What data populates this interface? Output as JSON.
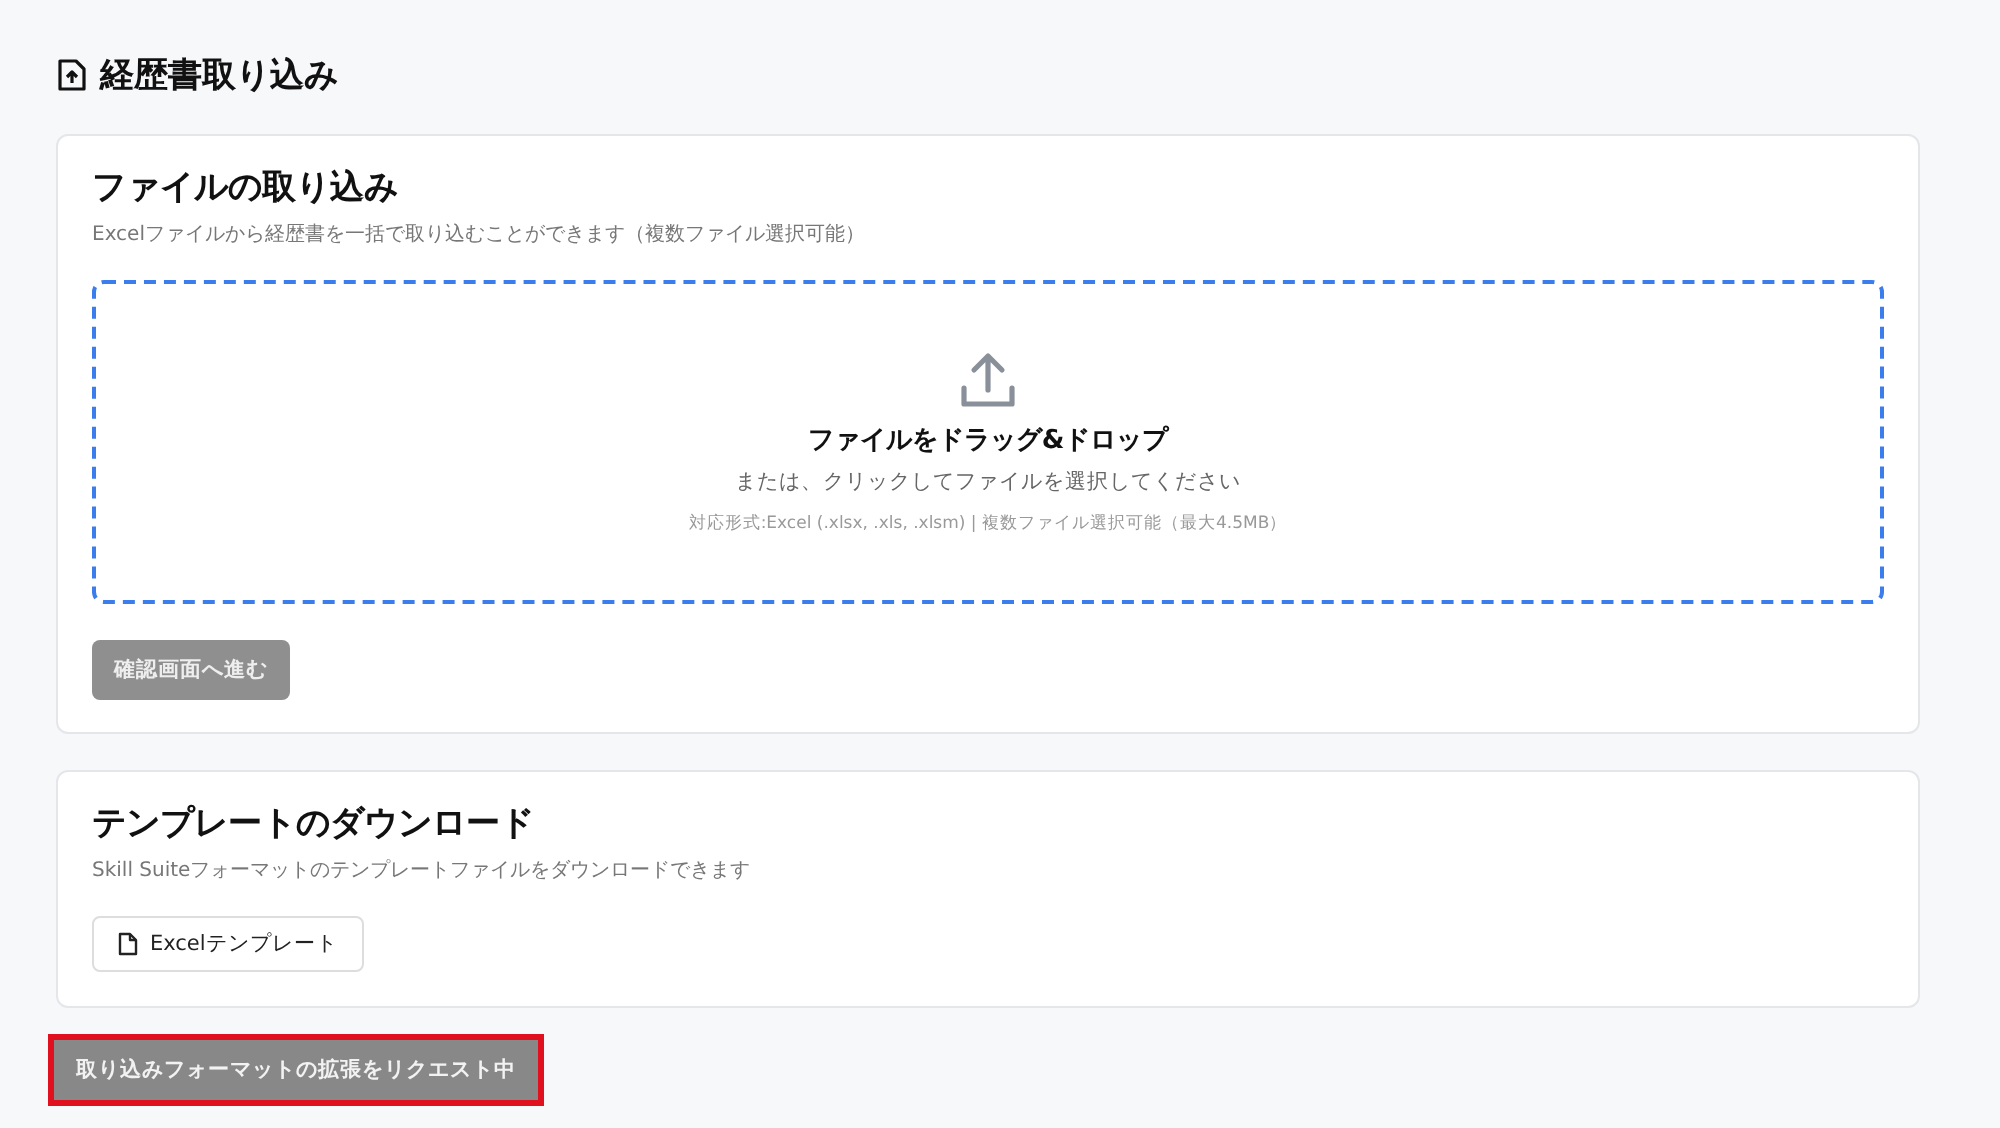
{
  "page": {
    "title": "経歴書取り込み"
  },
  "import_card": {
    "title": "ファイルの取り込み",
    "description": "Excelファイルから経歴書を一括で取り込むことができます（複数ファイル選択可能）",
    "dropzone": {
      "title": "ファイルをドラッグ&ドロップ",
      "subtitle": "または、クリックしてファイルを選択してください",
      "note": "対応形式:Excel (.xlsx, .xls, .xlsm) | 複数ファイル選択可能（最大4.5MB）"
    },
    "confirm_button": {
      "label": "確認画面へ進む",
      "disabled": true
    }
  },
  "template_card": {
    "title": "テンプレートのダウンロード",
    "description": "Skill Suiteフォーマットのテンプレートファイルをダウンロードできます",
    "button": {
      "label": "Excelテンプレート"
    }
  },
  "request_button": {
    "label": "取り込みフォーマットの拡張をリクエスト中",
    "highlighted": true
  }
}
